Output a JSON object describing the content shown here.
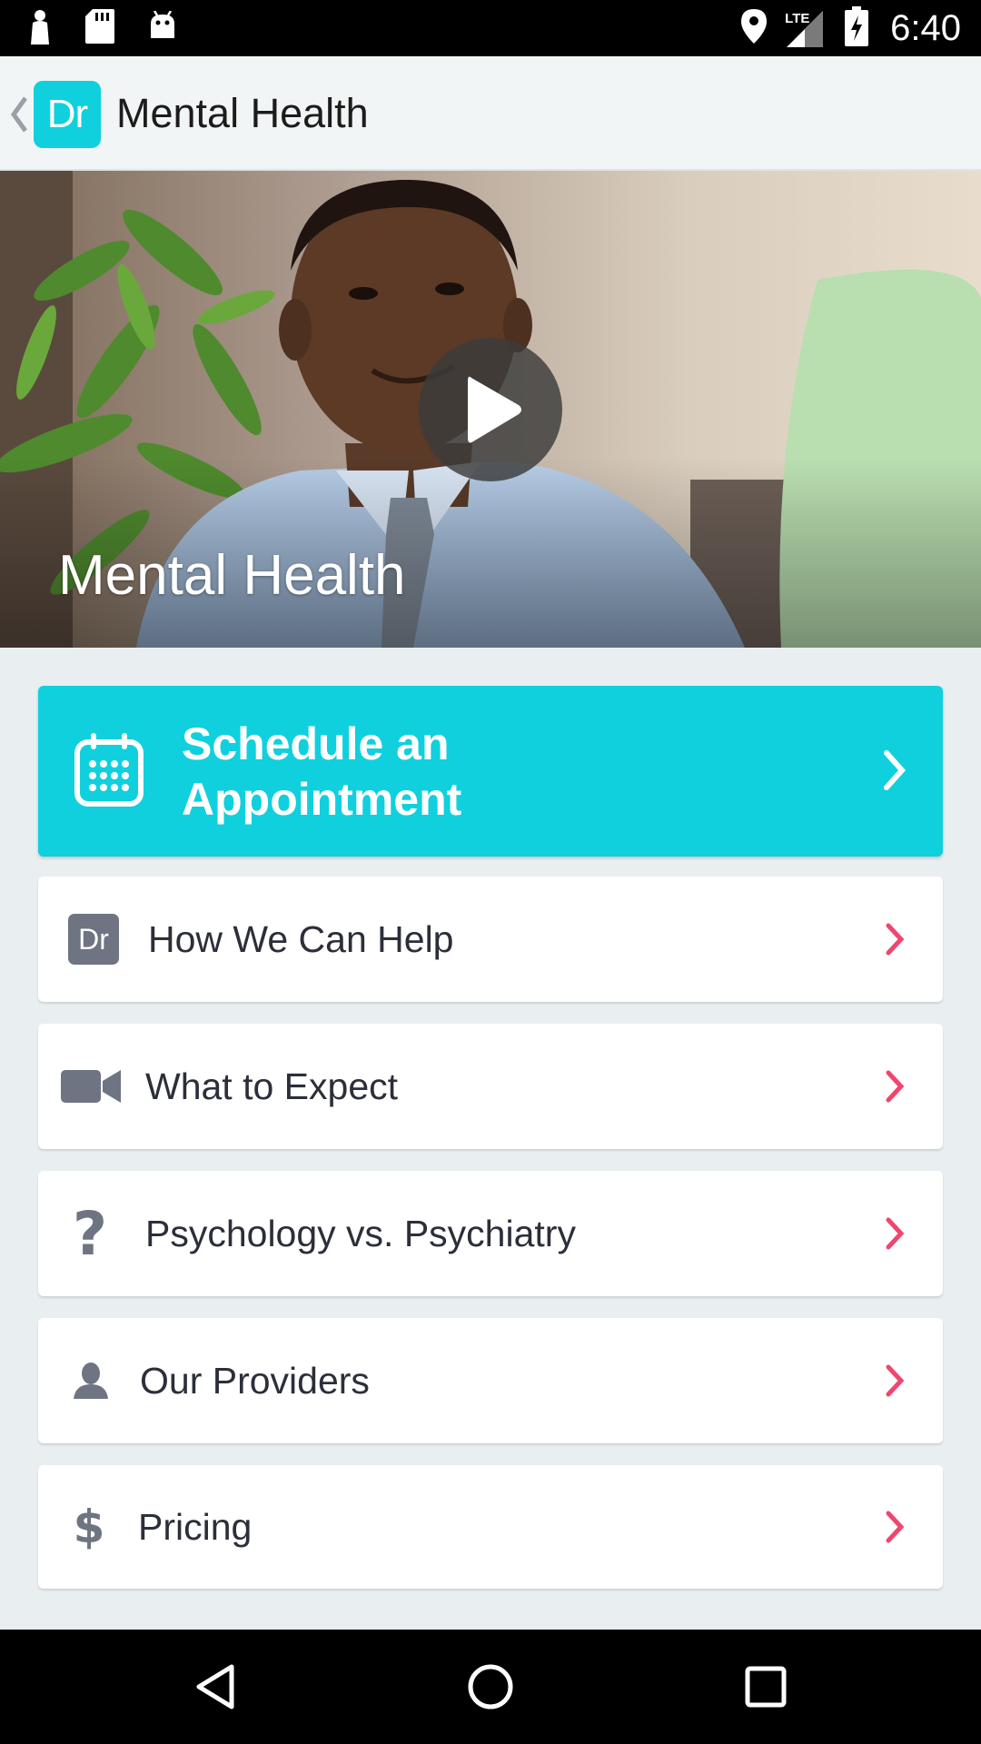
{
  "status_bar": {
    "time": "6:40",
    "network": "LTE",
    "icons": [
      "notification-icon",
      "sd-card-icon",
      "android-icon",
      "location-icon",
      "signal-icon",
      "battery-charging-icon"
    ]
  },
  "app_bar": {
    "logo_text": "Dr",
    "title": "Mental Health"
  },
  "hero": {
    "title": "Mental Health"
  },
  "cta": {
    "label_line1": "Schedule an",
    "label_line2": "Appointment",
    "icon": "calendar-icon"
  },
  "menu": {
    "items": [
      {
        "label": "How We Can Help",
        "icon": "dr-logo-icon"
      },
      {
        "label": "What to Expect",
        "icon": "video-camera-icon"
      },
      {
        "label": "Psychology vs. Psychiatry",
        "icon": "question-mark-icon"
      },
      {
        "label": "Our Providers",
        "icon": "person-icon"
      },
      {
        "label": "Pricing",
        "icon": "dollar-icon"
      }
    ],
    "icon_glyphs": {
      "dr_logo": "Dr",
      "question_mark": "?",
      "dollar": "$"
    }
  },
  "colors": {
    "accent": "#10d0de",
    "chevron": "#f0466e",
    "icon_gray": "#6e7482",
    "background": "#e9eff0"
  }
}
